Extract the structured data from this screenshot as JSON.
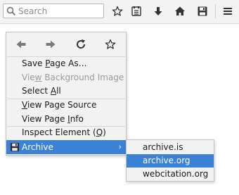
{
  "toolbar": {
    "search_placeholder": "Search",
    "icons": [
      "search-icon",
      "bookmark-star-icon",
      "reading-list-icon",
      "download-icon",
      "home-icon",
      "save-icon",
      "hamburger-menu-icon"
    ]
  },
  "context_menu": {
    "nav_icons": [
      "back-arrow-icon",
      "forward-arrow-icon",
      "reload-icon",
      "bookmark-star-icon"
    ],
    "items": [
      {
        "pre": "Save ",
        "u": "P",
        "post": "age As…",
        "disabled": false
      },
      {
        "pre": "Vie",
        "u": "w",
        "post": " Background Image",
        "disabled": true
      },
      {
        "pre": "Select ",
        "u": "A",
        "post": "ll",
        "disabled": false
      },
      {
        "pre": "",
        "u": "V",
        "post": "iew Page Source",
        "disabled": false
      },
      {
        "pre": "View Page ",
        "u": "I",
        "post": "nfo",
        "disabled": false
      },
      {
        "pre": "Inspect Element (",
        "u": "Q",
        "post": ")",
        "disabled": false
      }
    ],
    "archive": {
      "label": "Archive",
      "icon": "floppy-disk-icon",
      "arrow": "›"
    }
  },
  "submenu": {
    "items": [
      "archive.is",
      "archive.org",
      "webcitation.org"
    ],
    "highlighted_index": 1
  },
  "colors": {
    "highlight": "#3b82d6",
    "menu_bg": "#f2f2f2",
    "disabled_text": "#9b9b9b"
  }
}
